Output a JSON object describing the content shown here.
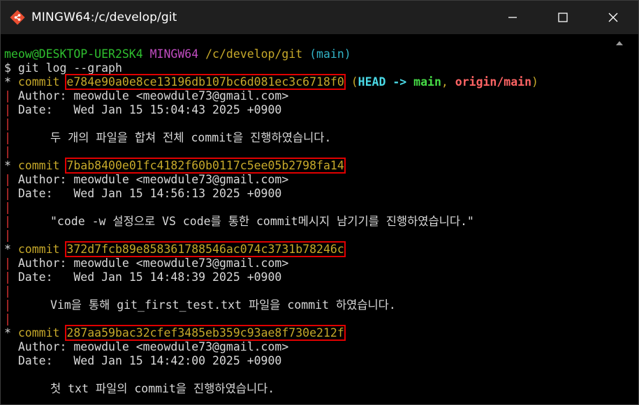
{
  "window": {
    "title": "MINGW64:/c/develop/git"
  },
  "prompt": {
    "user_host": "meow@DESKTOP-UER2SK4",
    "env": "MINGW64",
    "path": "/c/develop/git",
    "branch": "(main)",
    "command": "$ git log --graph"
  },
  "commits": [
    {
      "hash": "e784e90a0e8ce13196db107bc6d081ec3c6718f0",
      "refs": {
        "open": "(",
        "head": "HEAD -> ",
        "local": "main",
        "sep": ", ",
        "remote": "origin/main",
        "close": ")"
      },
      "author": "Author: meowdule <meowdule73@gmail.com>",
      "date": "Date:   Wed Jan 15 15:04:43 2025 +0900",
      "message": "두 개의 파일을 합쳐 전체 commit을 진행하였습니다."
    },
    {
      "hash": "7bab8400e01fc4182f60b0117c5ee05b2798fa14",
      "author": "Author: meowdule <meowdule73@gmail.com>",
      "date": "Date:   Wed Jan 15 14:56:13 2025 +0900",
      "message": "\"code -w 설정으로 VS code를 통한 commit메시지 남기기를 진행하였습니다.\""
    },
    {
      "hash": "372d7fcb89e858361788546ac074c3731b78246c",
      "author": "Author: meowdule <meowdule73@gmail.com>",
      "date": "Date:   Wed Jan 15 14:48:39 2025 +0900",
      "message": "Vim을 통해 git_first_test.txt 파일을 commit 하였습니다."
    },
    {
      "hash": "287aa59bac32cfef3485eb359c93ae8f730e212f",
      "author": "Author: meowdule <meowdule73@gmail.com>",
      "date": "Date:   Wed Jan 15 14:42:00 2025 +0900",
      "message": "첫 txt 파일의 commit을 진행하였습니다."
    }
  ],
  "labels": {
    "commit_word": "commit "
  },
  "colors": {
    "highlight": "#e00000",
    "titlebar": "#1f1f1f",
    "terminal_bg": "#000000"
  },
  "icons": {
    "app": "git-diamond-icon",
    "minimize": "minimize-icon",
    "maximize": "maximize-icon",
    "close": "close-icon"
  }
}
